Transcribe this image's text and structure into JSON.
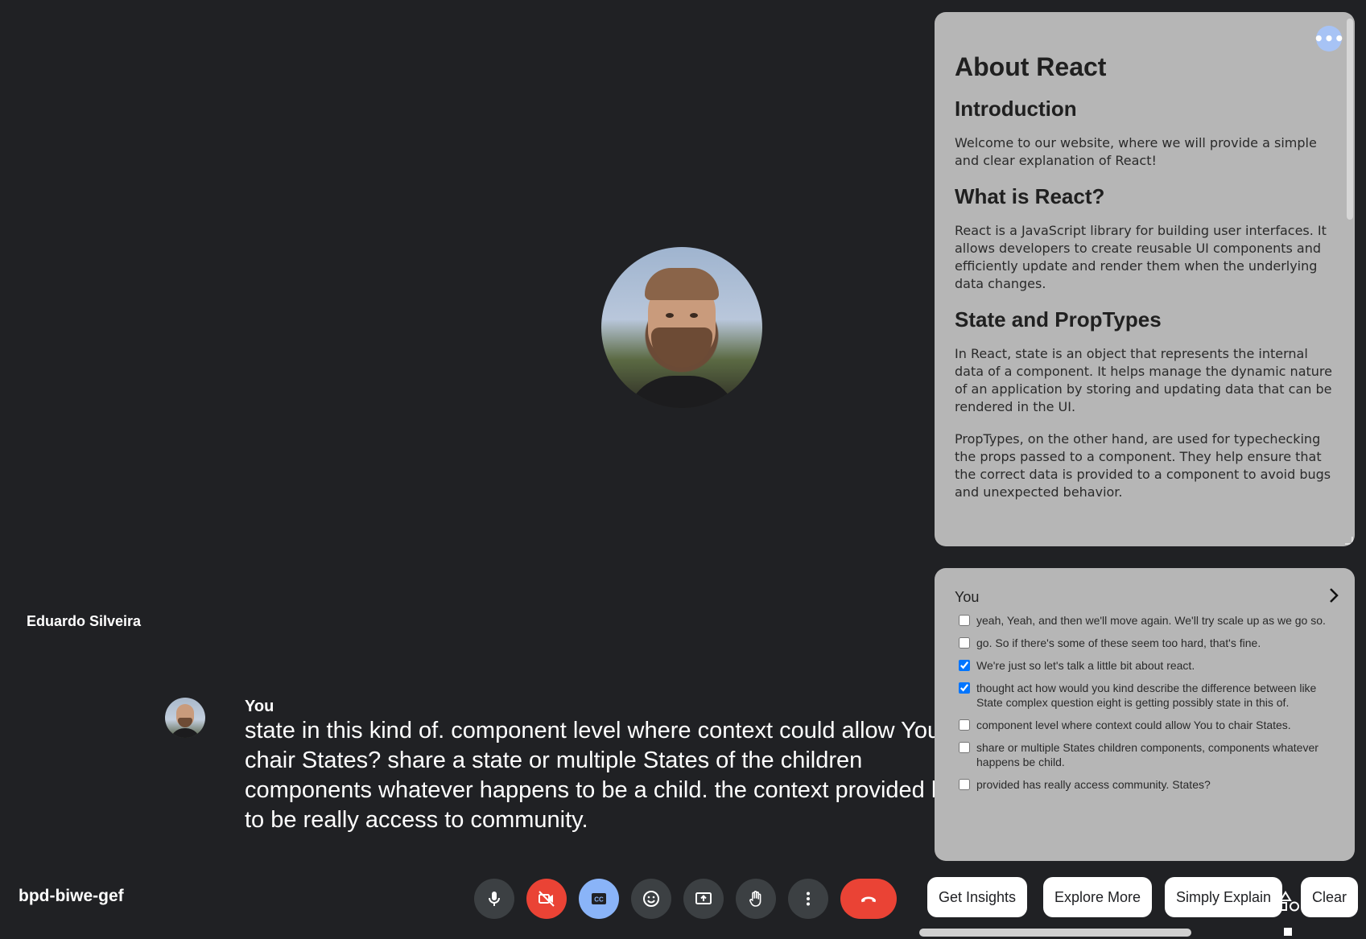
{
  "participant": {
    "name": "Eduardo Silveira"
  },
  "caption": {
    "speaker": "You",
    "text": "state in this kind of. component level where context could allow You to chair States? share a state or multiple States of the children components whatever happens to be a child. the context provided has to be really access to community."
  },
  "meeting": {
    "code": "bpd-biwe-gef"
  },
  "controls": {
    "mic": "microphone-icon",
    "camera": "camera-off-icon",
    "captions": "closed-captions-icon",
    "reactions": "emoji-icon",
    "present": "present-screen-icon",
    "raise_hand": "raise-hand-icon",
    "more": "more-options-icon",
    "end_call": "end-call-icon"
  },
  "info_panel": {
    "title": "About React",
    "sections": [
      {
        "heading": "Introduction",
        "paragraphs": [
          "Welcome to our website, where we will provide a simple and clear explanation of React!"
        ]
      },
      {
        "heading": "What is React?",
        "paragraphs": [
          "React is a JavaScript library for building user interfaces. It allows developers to create reusable UI components and efficiently update and render them when the underlying data changes."
        ]
      },
      {
        "heading": "State and PropTypes",
        "paragraphs": [
          "In React, state is an object that represents the internal data of a component. It helps manage the dynamic nature of an application by storing and updating data that can be rendered in the UI.",
          "PropTypes, on the other hand, are used for typechecking the props passed to a component. They help ensure that the correct data is provided to a component to avoid bugs and unexpected behavior."
        ]
      }
    ],
    "more_icon": "more-horizontal-icon"
  },
  "transcript_panel": {
    "title": "You",
    "items": [
      {
        "text": "yeah, Yeah, and then we'll move again. We'll try scale up as we go so.",
        "checked": false
      },
      {
        "text": "go. So if there's some of these seem too hard, that's fine.",
        "checked": false
      },
      {
        "text": "We're just so let's talk a little bit about react.",
        "checked": true
      },
      {
        "text": "thought act how would you kind describe the difference between like State complex question eight is getting possibly state in this of.",
        "checked": true
      },
      {
        "text": "component level where context could allow You to chair States.",
        "checked": false
      },
      {
        "text": "share or multiple States children components, components whatever happens be child.",
        "checked": false
      },
      {
        "text": "provided has really access community. States?",
        "checked": false
      }
    ]
  },
  "actions": {
    "get_insights": "Get Insights",
    "explore_more": "Explore More",
    "simply_explain": "Simply Explain",
    "clear": "Clear"
  },
  "colors": {
    "background": "#202124",
    "end_call": "#ea4335",
    "captions_active": "#8ab4f8",
    "panel": "#b6b6b6"
  }
}
